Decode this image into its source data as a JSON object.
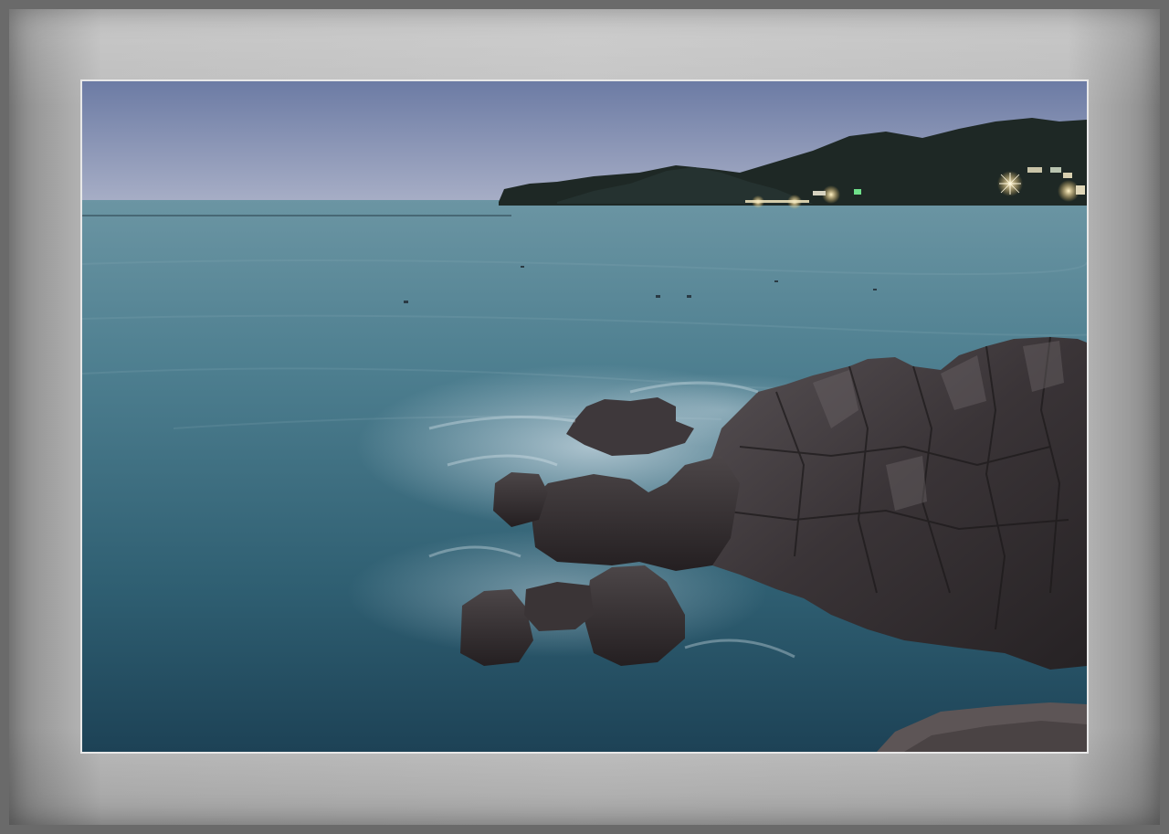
{
  "image": {
    "subject": "seascape-at-dusk",
    "colors": {
      "sky_top": "#6f7ea6",
      "sky_horizon": "#a4acc4",
      "sea_far": "#5f8a9a",
      "sea_mid": "#3f6f80",
      "sea_near": "#234a5c",
      "rock": "#3a3538",
      "hills": "#1f2a26",
      "lights": "#ffd27a",
      "mat": "#c2c2c2",
      "frame": "#6a6a6a"
    }
  }
}
